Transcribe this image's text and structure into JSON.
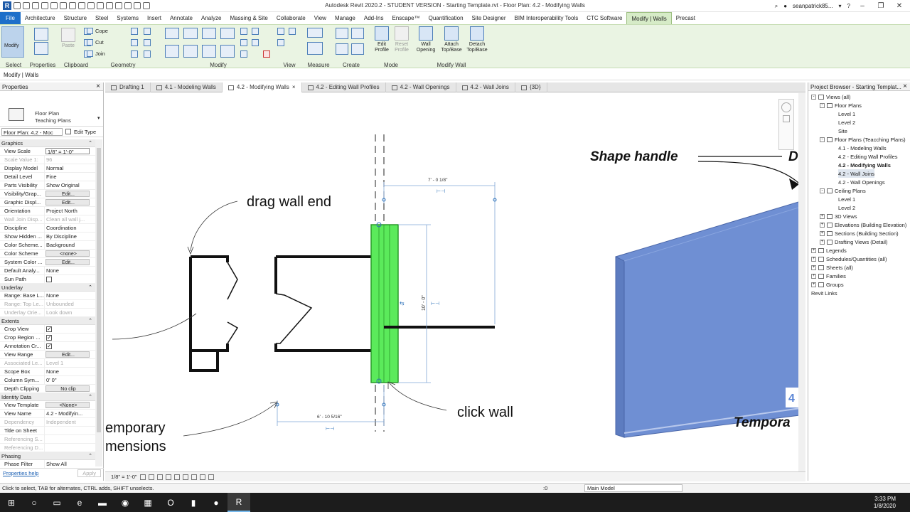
{
  "window": {
    "title": "Autodesk Revit 2020.2 - STUDENT VERSION - Starting Template.rvt - Floor Plan: 4.2 - Modifying Walls",
    "user": "seanpatrick85...",
    "logo": "R"
  },
  "ribbon_tabs": [
    "File",
    "Architecture",
    "Structure",
    "Steel",
    "Systems",
    "Insert",
    "Annotate",
    "Analyze",
    "Massing & Site",
    "Collaborate",
    "View",
    "Manage",
    "Add-Ins",
    "Enscape™",
    "Quantification",
    "Site Designer",
    "BIM Interoperability Tools",
    "CTC Software",
    "Modify | Walls",
    "Precast"
  ],
  "ribbon": {
    "modify": "Modify",
    "select": "Select",
    "properties": "Properties",
    "paste": "Paste",
    "clipboard": "Clipboard",
    "cope": "Cope",
    "cut": "Cut",
    "join": "Join",
    "geometry": "Geometry",
    "modify_group": "Modify",
    "view": "View",
    "measure": "Measure",
    "create": "Create",
    "edit_profile": "Edit Profile",
    "reset_profile": "Reset Profile",
    "mode": "Mode",
    "wall_opening": "Wall Opening",
    "attach": "Attach Top/Base",
    "detach": "Detach Top/Base",
    "modify_wall": "Modify Wall"
  },
  "option_bar": "Modify | Walls",
  "properties": {
    "title": "Properties",
    "type_name": "Floor Plan\nTeaching Plans",
    "instance_selector": "Floor Plan: 4.2 - Moc",
    "edit_type": "Edit Type",
    "categories": [
      {
        "name": "Graphics",
        "rows": [
          {
            "k": "View Scale",
            "v": "1/8\" = 1'-0\"",
            "kind": "box"
          },
          {
            "k": "Scale Value    1:",
            "v": "96",
            "kind": "dim"
          },
          {
            "k": "Display Model",
            "v": "Normal"
          },
          {
            "k": "Detail Level",
            "v": "Fine"
          },
          {
            "k": "Parts Visibility",
            "v": "Show Original"
          },
          {
            "k": "Visibility/Grap...",
            "v": "Edit...",
            "kind": "btn"
          },
          {
            "k": "Graphic Displ...",
            "v": "Edit...",
            "kind": "btn"
          },
          {
            "k": "Orientation",
            "v": "Project North"
          },
          {
            "k": "Wall Join Disp...",
            "v": "Clean all wall j...",
            "kind": "dim"
          },
          {
            "k": "Discipline",
            "v": "Coordination"
          },
          {
            "k": "Show Hidden ...",
            "v": "By Discipline"
          },
          {
            "k": "Color Scheme...",
            "v": "Background"
          },
          {
            "k": "Color Scheme",
            "v": "<none>",
            "kind": "btn"
          },
          {
            "k": "System Color ...",
            "v": "Edit...",
            "kind": "btn"
          },
          {
            "k": "Default Analy...",
            "v": "None"
          },
          {
            "k": "Sun Path",
            "v": "",
            "kind": "cb"
          }
        ]
      },
      {
        "name": "Underlay",
        "rows": [
          {
            "k": "Range: Base L...",
            "v": "None"
          },
          {
            "k": "Range: Top Le...",
            "v": "Unbounded",
            "kind": "dim"
          },
          {
            "k": "Underlay Orie...",
            "v": "Look down",
            "kind": "dim"
          }
        ]
      },
      {
        "name": "Extents",
        "rows": [
          {
            "k": "Crop View",
            "v": "",
            "kind": "cbon"
          },
          {
            "k": "Crop Region ...",
            "v": "",
            "kind": "cbon"
          },
          {
            "k": "Annotation Cr...",
            "v": "",
            "kind": "cbon"
          },
          {
            "k": "View Range",
            "v": "Edit...",
            "kind": "btn"
          },
          {
            "k": "Associated Le...",
            "v": "Level 1",
            "kind": "dim"
          },
          {
            "k": "Scope Box",
            "v": "None"
          },
          {
            "k": "Column Sym...",
            "v": "0'  0\""
          },
          {
            "k": "Depth Clipping",
            "v": "No clip",
            "kind": "btn"
          }
        ]
      },
      {
        "name": "Identity Data",
        "rows": [
          {
            "k": "View Template",
            "v": "<None>",
            "kind": "btn"
          },
          {
            "k": "View Name",
            "v": "4.2 - Modifyin..."
          },
          {
            "k": "Dependency",
            "v": "Independent",
            "kind": "dim"
          },
          {
            "k": "Title on Sheet",
            "v": ""
          },
          {
            "k": "Referencing S...",
            "v": "",
            "kind": "dim"
          },
          {
            "k": "Referencing D...",
            "v": "",
            "kind": "dim"
          }
        ]
      },
      {
        "name": "Phasing",
        "rows": [
          {
            "k": "Phase Filter",
            "v": "Show All"
          }
        ]
      }
    ],
    "help": "Properties help",
    "apply": "Apply"
  },
  "view_tabs": [
    {
      "label": "Drafting 1",
      "active": false
    },
    {
      "label": "4.1 - Modeling Walls",
      "active": false
    },
    {
      "label": "4.2 - Modifying Walls",
      "active": true
    },
    {
      "label": "4.2 - Editing Wall Profiles",
      "active": false
    },
    {
      "label": "4.2 - Wall Openings",
      "active": false
    },
    {
      "label": "4.2 - Wall Joins",
      "active": false
    },
    {
      "label": "{3D}",
      "active": false
    }
  ],
  "canvas": {
    "drag_wall_end": "drag wall end",
    "click_wall": "click wall",
    "temp_dim_1": "emporary",
    "temp_dim_2": "mensions",
    "shape_handle": "Shape handle",
    "shape_handle_d": "D",
    "temporary": "Tempora",
    "badge": "4",
    "dim_top": "7' - 0 1/8\"",
    "dim_vertical": "10' - 0\"",
    "dim_bottom": "6' - 10 5/16\"",
    "wall_color": "#5bea5b",
    "wall3d_color": "#6f8fd3"
  },
  "view_control": {
    "scale": "1/8\" = 1'-0\""
  },
  "project_browser": {
    "title": "Project Browser - Starting Templat...",
    "nodes": [
      {
        "label": "Views (all)",
        "level": 0,
        "exp": "-"
      },
      {
        "label": "Floor Plans",
        "level": 1,
        "exp": "-"
      },
      {
        "label": "Level 1",
        "level": 2
      },
      {
        "label": "Level 2",
        "level": 2
      },
      {
        "label": "Site",
        "level": 2
      },
      {
        "label": "Floor Plans (Teacching Plans)",
        "level": 1,
        "exp": "-"
      },
      {
        "label": "4.1 - Modeling Walls",
        "level": 2
      },
      {
        "label": "4.2 - Editing Wall Profiles",
        "level": 2
      },
      {
        "label": "4.2 - Modifying Walls",
        "level": 2,
        "bold": true
      },
      {
        "label": "4.2 - Wall Joins",
        "level": 2,
        "sel": true
      },
      {
        "label": "4.2 - Wall Openings",
        "level": 2
      },
      {
        "label": "Ceiling Plans",
        "level": 1,
        "exp": "-"
      },
      {
        "label": "Level 1",
        "level": 2
      },
      {
        "label": "Level 2",
        "level": 2
      },
      {
        "label": "3D Views",
        "level": 1,
        "exp": "+"
      },
      {
        "label": "Elevations (Building Elevation)",
        "level": 1,
        "exp": "+"
      },
      {
        "label": "Sections (Building Section)",
        "level": 1,
        "exp": "+"
      },
      {
        "label": "Drafting Views (Detail)",
        "level": 1,
        "exp": "+"
      },
      {
        "label": "Legends",
        "level": 0,
        "exp": "+"
      },
      {
        "label": "Schedules/Quantities (all)",
        "level": 0,
        "exp": "+"
      },
      {
        "label": "Sheets (all)",
        "level": 0,
        "exp": "+"
      },
      {
        "label": "Families",
        "level": 0,
        "exp": "+"
      },
      {
        "label": "Groups",
        "level": 0,
        "exp": "+"
      },
      {
        "label": "Revit Links",
        "level": 0
      }
    ]
  },
  "status": {
    "hint": "Click to select, TAB for alternates, CTRL adds, SHIFT unselects.",
    "zero": ":0",
    "model": "Main Model"
  },
  "taskbar": {
    "time": "3:33 PM",
    "date": "1/8/2020"
  }
}
